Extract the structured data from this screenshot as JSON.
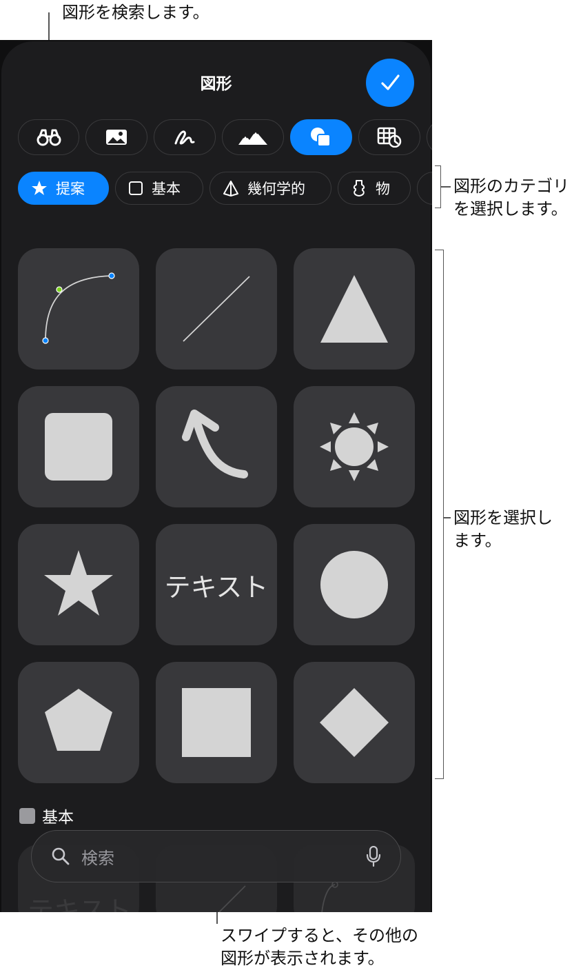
{
  "callouts": {
    "search_shapes": "図形を検索します。",
    "category_line1": "図形のカテゴリ",
    "category_line2": "を選択します。",
    "select_line1": "図形を選択し",
    "select_line2": "ます。",
    "swipe_line1": "スワイプすると、その他の",
    "swipe_line2": "図形が表示されます。"
  },
  "header": {
    "title": "図形"
  },
  "toolbar": {
    "items": [
      {
        "icon": "binoculars-icon",
        "active": false
      },
      {
        "icon": "photo-icon",
        "active": false
      },
      {
        "icon": "scribble-icon",
        "active": false
      },
      {
        "icon": "mountains-icon",
        "active": false
      },
      {
        "icon": "shapes-icon",
        "active": true
      },
      {
        "icon": "table-chart-icon",
        "active": false
      }
    ]
  },
  "categories": [
    {
      "label": "提案",
      "icon": "star-icon",
      "active": true
    },
    {
      "label": "基本",
      "icon": "square-icon",
      "active": false
    },
    {
      "label": "幾何学的",
      "icon": "pyramid-icon",
      "active": false
    },
    {
      "label": "物",
      "icon": "object-icon",
      "active": false
    }
  ],
  "shapes": [
    {
      "name": "curve"
    },
    {
      "name": "line"
    },
    {
      "name": "triangle"
    },
    {
      "name": "rounded-square"
    },
    {
      "name": "curved-arrow"
    },
    {
      "name": "sun"
    },
    {
      "name": "star"
    },
    {
      "name": "text",
      "label": "テキスト"
    },
    {
      "name": "circle"
    },
    {
      "name": "pentagon"
    },
    {
      "name": "square"
    },
    {
      "name": "diamond"
    }
  ],
  "section": {
    "label": "基本"
  },
  "ghost": {
    "text": "テキスト"
  },
  "search": {
    "placeholder": "検索"
  },
  "colors": {
    "accent": "#0a84ff",
    "tile": "#38383b",
    "shape": "#d4d4d4",
    "background": "#1c1c1e"
  }
}
